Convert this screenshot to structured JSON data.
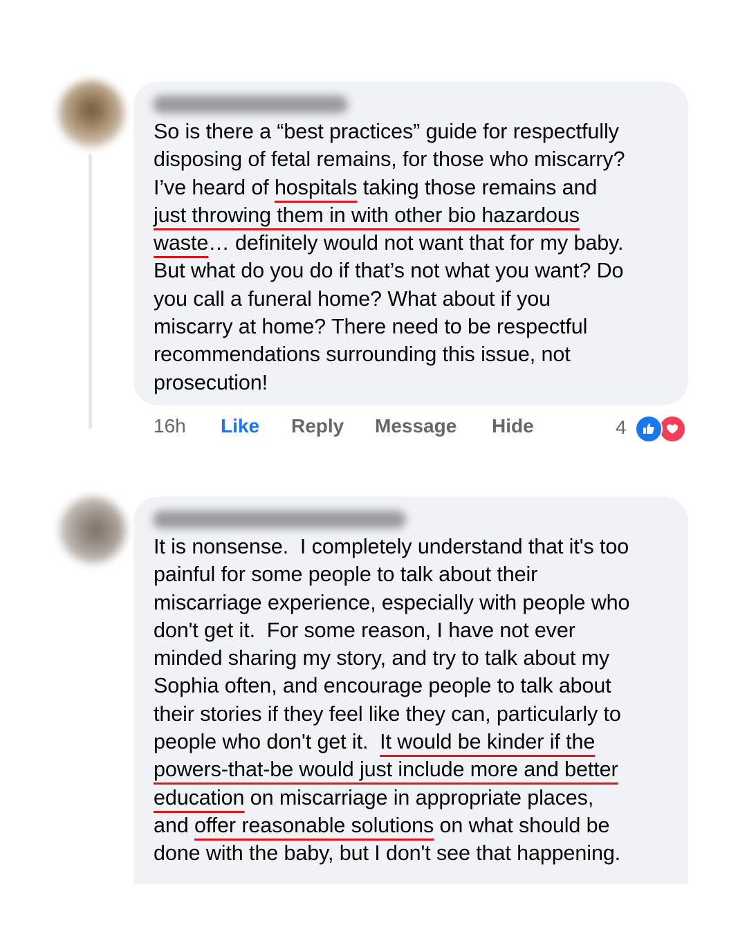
{
  "comments": [
    {
      "lines": [
        "So is there a “best practices” guide for respectfully",
        "disposing of fetal remains, for those who miscarry?"
      ],
      "line3_a": "I’ve heard of ",
      "line3_u": "hospitals",
      "line3_b": " taking those remains and",
      "line4_u": "just throwing them in with other bio hazardous",
      "line5_u": "waste",
      "line5_b": "… definitely would not want that for my baby.",
      "rest": [
        "But what do you do if that’s not what you want? Do",
        "you call a funeral home? What about if you",
        "miscarry at home? There need to be respectful",
        "recommendations surrounding this issue, not",
        "prosecution!"
      ],
      "time": "16h",
      "like": "Like",
      "reply": "Reply",
      "message": "Message",
      "hide": "Hide",
      "reaction_count": "4",
      "reaction_icons": [
        "thumbs-up-icon",
        "heart-icon"
      ]
    },
    {
      "lines": [
        "It is nonsense.  I completely understand that it's too",
        "painful for some people to talk about their",
        "miscarriage experience, especially with people who",
        "don't get it.  For some reason, I have not ever",
        "minded sharing my story, and try to talk about my",
        "Sophia often, and encourage people to talk about",
        "their stories if they feel like they can, particularly to"
      ],
      "line8_a": "people who don't get it.  ",
      "line8_u": "It would be kinder if the",
      "line9_u1": "powers-that-be would just include ",
      "line9_u2": "more and better",
      "line10_u": "education",
      "line10_b": " on miscarriage in appropriate places,",
      "line11_a": "and ",
      "line11_u": "offer reasonable solutions",
      "line11_b": " on what should be",
      "line12": "done with the baby, but I don't see that happening."
    }
  ],
  "colors": {
    "bubble": "#f0f2f5",
    "like_blue": "#1877f2",
    "underline_red": "#e0141b",
    "meta_gray": "#65676b"
  }
}
